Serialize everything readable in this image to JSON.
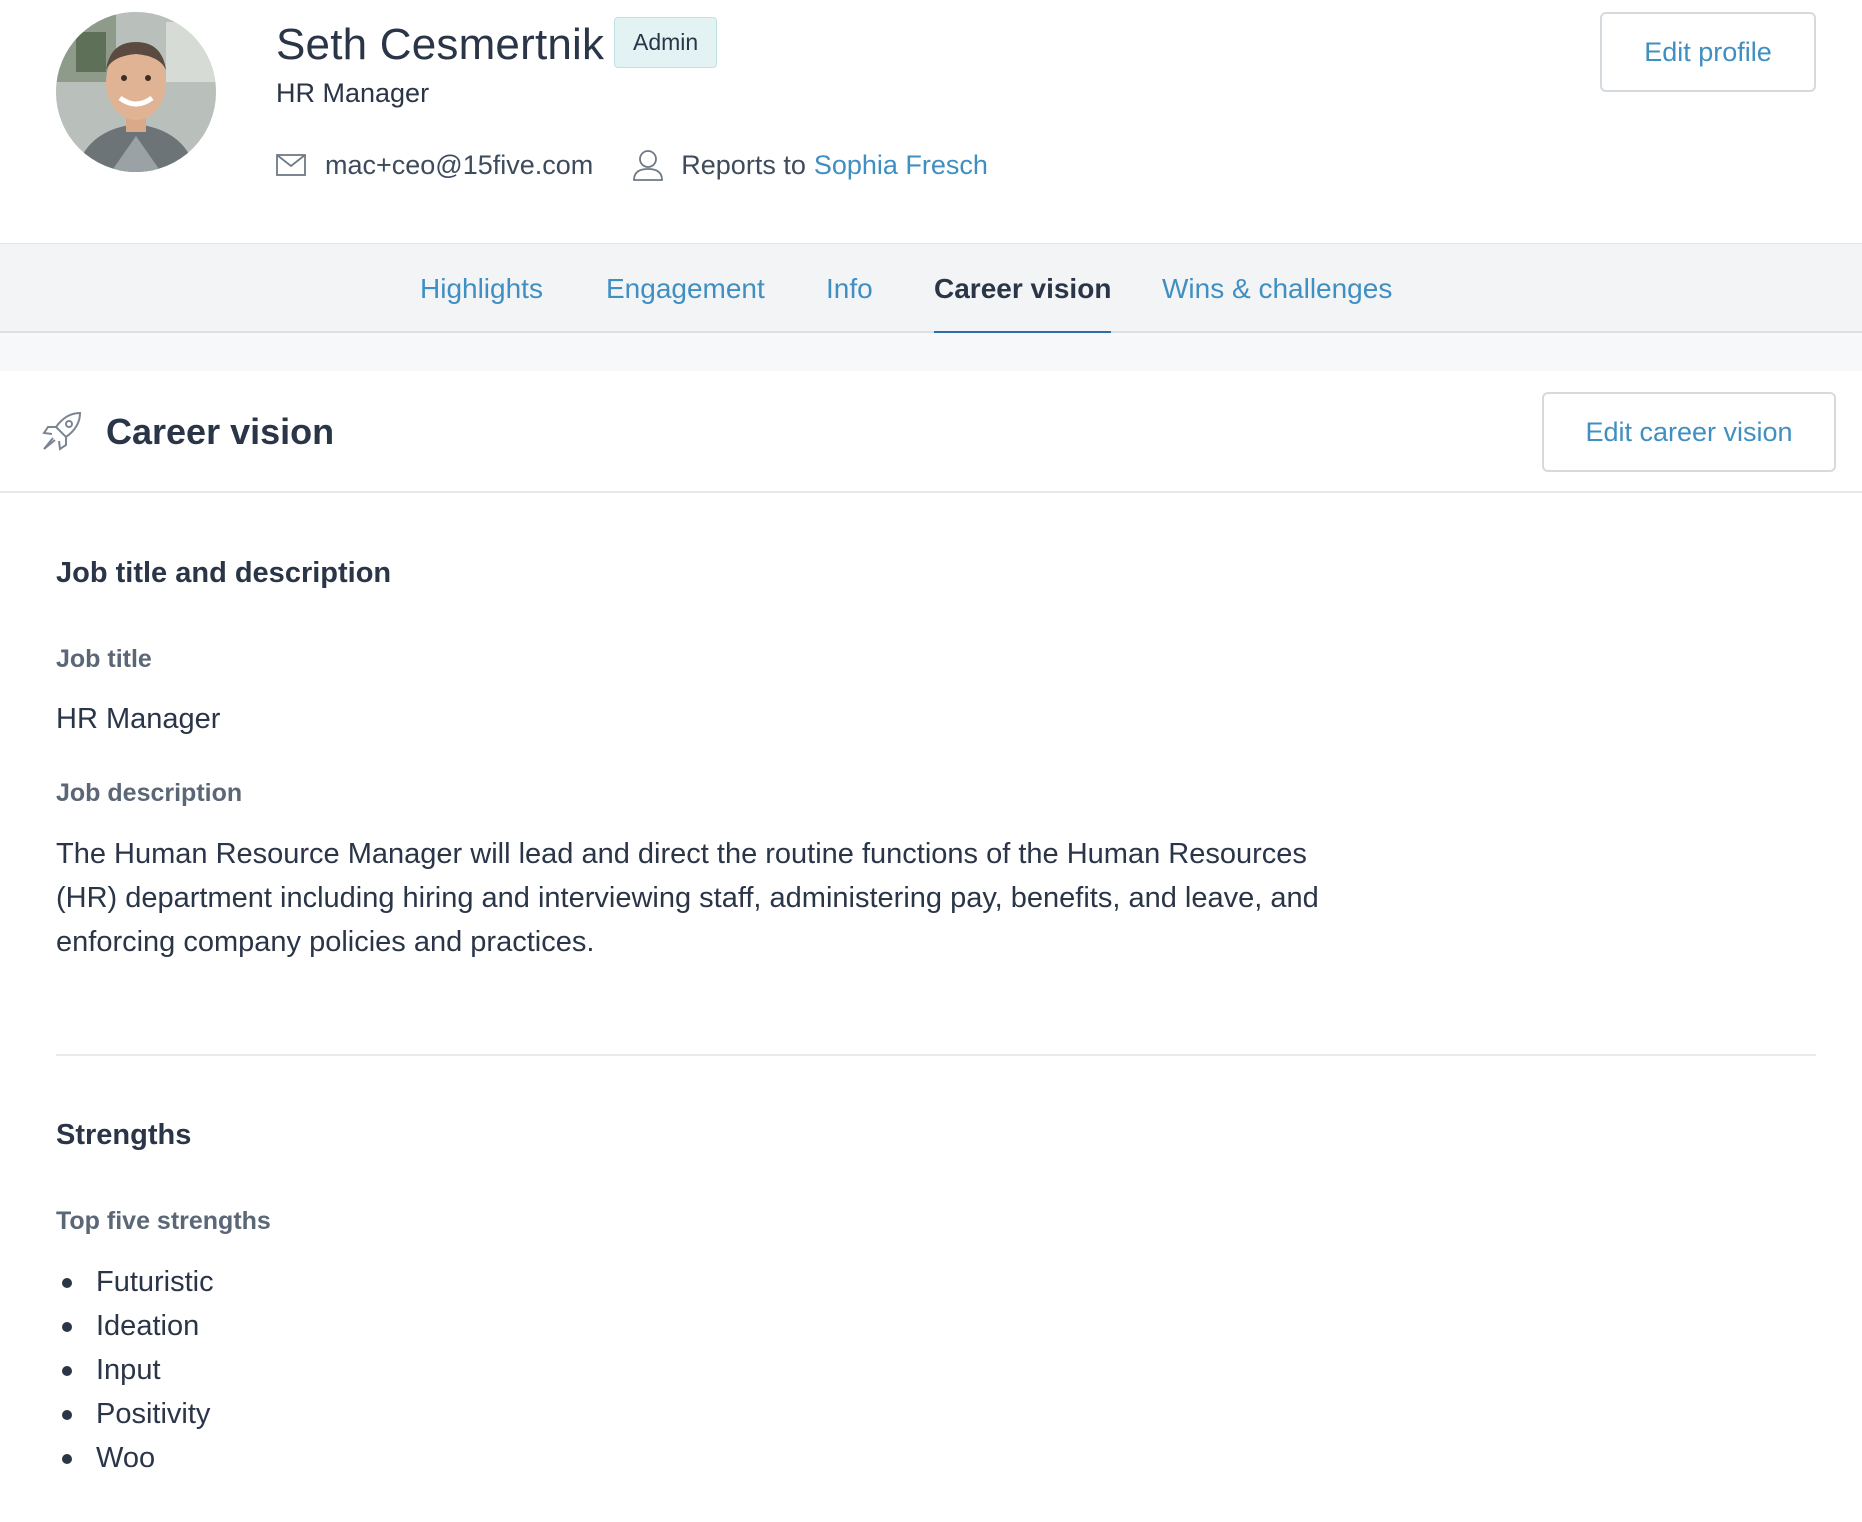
{
  "profile": {
    "name": "Seth Cesmertnik",
    "badge": "Admin",
    "role": "HR Manager",
    "email": "mac+ceo@15five.com",
    "reports_to_label": "Reports to",
    "reports_to_name": "Sophia Fresch",
    "edit_button": "Edit profile"
  },
  "tabs": [
    {
      "label": "Highlights",
      "active": false
    },
    {
      "label": "Engagement",
      "active": false
    },
    {
      "label": "Info",
      "active": false
    },
    {
      "label": "Career vision",
      "active": true
    },
    {
      "label": "Wins & challenges",
      "active": false
    }
  ],
  "section": {
    "title": "Career vision",
    "edit_button": "Edit career vision",
    "icon": "rocket-icon"
  },
  "job": {
    "heading": "Job title and description",
    "title_label": "Job title",
    "title_value": "HR Manager",
    "description_label": "Job description",
    "description_value": "The Human Resource Manager will lead and direct the routine functions of the Human Resources (HR) department including hiring and interviewing staff, administering pay, benefits, and leave, and enforcing company policies and practices."
  },
  "strengths": {
    "heading": "Strengths",
    "label": "Top five strengths",
    "items": [
      "Futuristic",
      "Ideation",
      "Input",
      "Positivity",
      "Woo"
    ]
  },
  "colors": {
    "link": "#3f8fc2",
    "text": "#2a3547",
    "active_tab_underline": "#2c6ea7",
    "badge_bg": "#e3f3f3"
  }
}
